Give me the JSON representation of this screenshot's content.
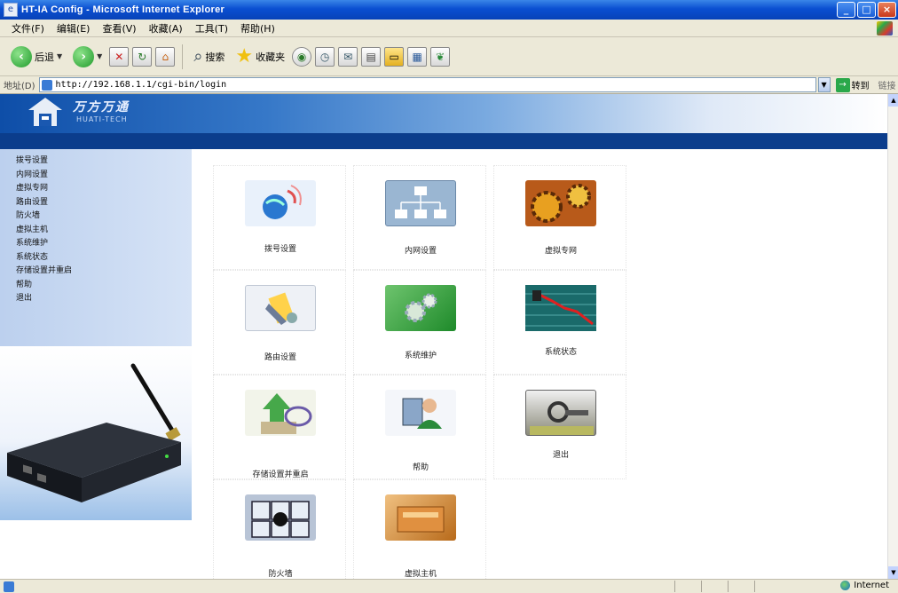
{
  "window": {
    "title": "HT-IA Config - Microsoft Internet Explorer",
    "min": "_",
    "max": "□",
    "close": "×"
  },
  "menu": [
    "文件(F)",
    "编辑(E)",
    "查看(V)",
    "收藏(A)",
    "工具(T)",
    "帮助(H)"
  ],
  "toolbar": {
    "back_label": "后退",
    "search_label": "搜索",
    "favorites_label": "收藏夹"
  },
  "address": {
    "label": "地址(D)",
    "url": "http://192.168.1.1/cgi-bin/login",
    "go_label": "转到",
    "links_label": "链接"
  },
  "brand": {
    "name": "万方万通",
    "sub": "HUATI-TECH"
  },
  "sidebar": {
    "items": [
      "拨号设置",
      "内网设置",
      "虚拟专网",
      "路由设置",
      "防火墙",
      "虚拟主机",
      "系统维护",
      "系统状态",
      "存储设置并重启",
      "帮助",
      "退出"
    ]
  },
  "tiles": [
    {
      "label": "拨号设置",
      "icon": "globe-signal-icon",
      "color": "#e9f1fb"
    },
    {
      "label": "内网设置",
      "icon": "network-diagram-icon",
      "color": "#9ab6d2"
    },
    {
      "label": "虚拟专网",
      "icon": "gears-icon",
      "color": "#b85a1a"
    },
    {
      "label": "路由设置",
      "icon": "router-hand-icon",
      "color": "#eef1f6"
    },
    {
      "label": "系统维护",
      "icon": "green-gears-icon",
      "color": "#3aa43a"
    },
    {
      "label": "系统状态",
      "icon": "graph-monitor-icon",
      "color": "#2a8c8c"
    },
    {
      "label": "存储设置并重启",
      "icon": "storage-arrow-icon",
      "color": "#f2f4ea"
    },
    {
      "label": "帮助",
      "icon": "help-person-icon",
      "color": "#f4f6fa"
    },
    {
      "label": "退出",
      "icon": "exit-icon",
      "color": "#8a8a7a"
    },
    {
      "label": "防火墙",
      "icon": "firewall-puzzle-icon",
      "color": "#b8c4d6"
    },
    {
      "label": "虚拟主机",
      "icon": "server-block-icon",
      "color": "#d4842a"
    }
  ],
  "status": {
    "zone": "Internet"
  }
}
